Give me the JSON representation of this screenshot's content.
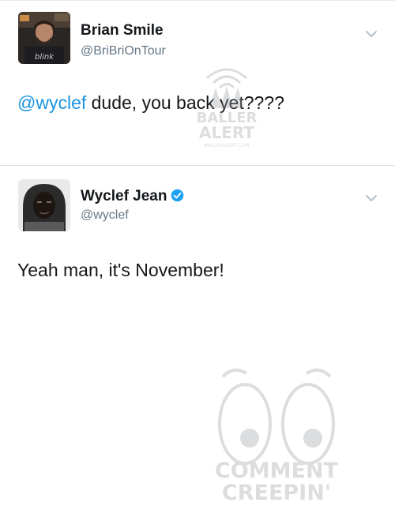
{
  "tweets": [
    {
      "name": "Brian Smile",
      "handle": "@BriBriOnTour",
      "mention": "@wyclef",
      "text": " dude, you back yet????",
      "avatar_shirt_text": "blink"
    },
    {
      "name": "Wyclef Jean",
      "handle": "@wyclef",
      "text": "Yeah man, it's November!",
      "verified": true
    }
  ],
  "watermarks": {
    "ballers_line1": "BALLER",
    "ballers_line2": "ALERT",
    "ballers_url": "BALLERALERT.COM",
    "comment_line1": "COMMENT",
    "comment_line2": "CREEPIN'"
  },
  "colors": {
    "mention": "#1b95e0",
    "handle": "#657786",
    "verified": "#1da1f2"
  }
}
